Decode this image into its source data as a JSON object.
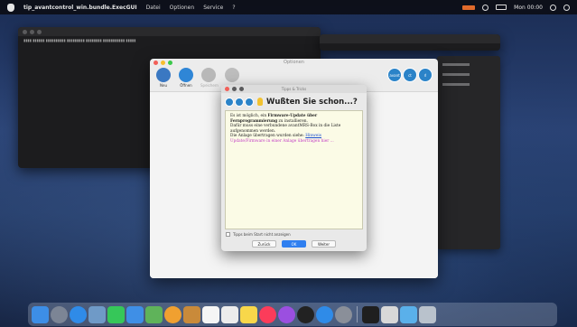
{
  "menubar": {
    "app_name": "tip_avantcontrol_win.bundle.ExecGUI",
    "menus": [
      "Datei",
      "Optionen",
      "Service",
      "?"
    ],
    "clock": "Mon 00:00"
  },
  "main_window": {
    "title": "Optionen",
    "toolbar": [
      {
        "label": "Neu",
        "enabled": true,
        "icon": "new-icon",
        "color": "#3a78c2"
      },
      {
        "label": "Öffnen",
        "enabled": true,
        "icon": "open-icon",
        "color": "#2f86d6"
      },
      {
        "label": "Speichern",
        "enabled": false,
        "icon": "save-icon",
        "color": "#b8b8b8"
      },
      {
        "label": "",
        "enabled": false,
        "icon": "disabled-icon",
        "color": "#bdbdbd"
      }
    ],
    "brand_letters": [
      "avant",
      "ct",
      "rl"
    ]
  },
  "dialog": {
    "window_title": "Tipps & Tricks",
    "heading": "Wußten Sie schon...?",
    "tip": {
      "p1_prefix": "Es ist möglich, ein ",
      "p1_bold": "Firmware-Update über Fernprogrammierung",
      "p1_suffix": " zu installieren.",
      "p2": "Dafür muss eine verbundene avantMRS-Box in die Liste aufgenommen werden.",
      "p3_prefix": "Die Anlage übertragen wurden siehe: ",
      "p3_link": "Hinweis",
      "p3_magenta": "Update/Firmware in einer Anlage übertragen hier ...",
      "p3_tail": ""
    },
    "checkbox_label": "Tipps beim Start nicht anzeigen",
    "buttons": {
      "prev": "Zurück",
      "ok": "OK",
      "next": "Weiter"
    }
  },
  "dock": {
    "apps": [
      {
        "name": "finder-icon",
        "color": "#3d8ee6"
      },
      {
        "name": "launchpad-icon",
        "color": "#7c8595",
        "round": true
      },
      {
        "name": "safari-icon",
        "color": "#2f8be8",
        "round": true
      },
      {
        "name": "preview-icon",
        "color": "#6f9ac7"
      },
      {
        "name": "messages-icon",
        "color": "#36c759"
      },
      {
        "name": "mail-icon",
        "color": "#3f8fe6"
      },
      {
        "name": "maps-icon",
        "color": "#5fb35a"
      },
      {
        "name": "photos-icon",
        "color": "#f0a030",
        "round": true
      },
      {
        "name": "notes-app-icon",
        "color": "#c98a3a"
      },
      {
        "name": "calendar-icon",
        "color": "#f5f5f5"
      },
      {
        "name": "reminders-icon",
        "color": "#ececec"
      },
      {
        "name": "notes-icon",
        "color": "#f8d74a"
      },
      {
        "name": "music-icon",
        "color": "#fc3c5a",
        "round": true
      },
      {
        "name": "podcasts-icon",
        "color": "#9b4fe0",
        "round": true
      },
      {
        "name": "appletv-icon",
        "color": "#222222",
        "round": true
      },
      {
        "name": "appstore-icon",
        "color": "#2f8be8",
        "round": true
      },
      {
        "name": "settings-icon",
        "color": "#8a8f99",
        "round": true
      }
    ],
    "apps_right": [
      {
        "name": "terminal-icon",
        "color": "#1f1f1f"
      },
      {
        "name": "app-icon",
        "color": "#d8d8d8"
      },
      {
        "name": "folder-icon",
        "color": "#5ab0ea"
      },
      {
        "name": "trash-icon",
        "color": "#b9c2cc"
      }
    ]
  }
}
